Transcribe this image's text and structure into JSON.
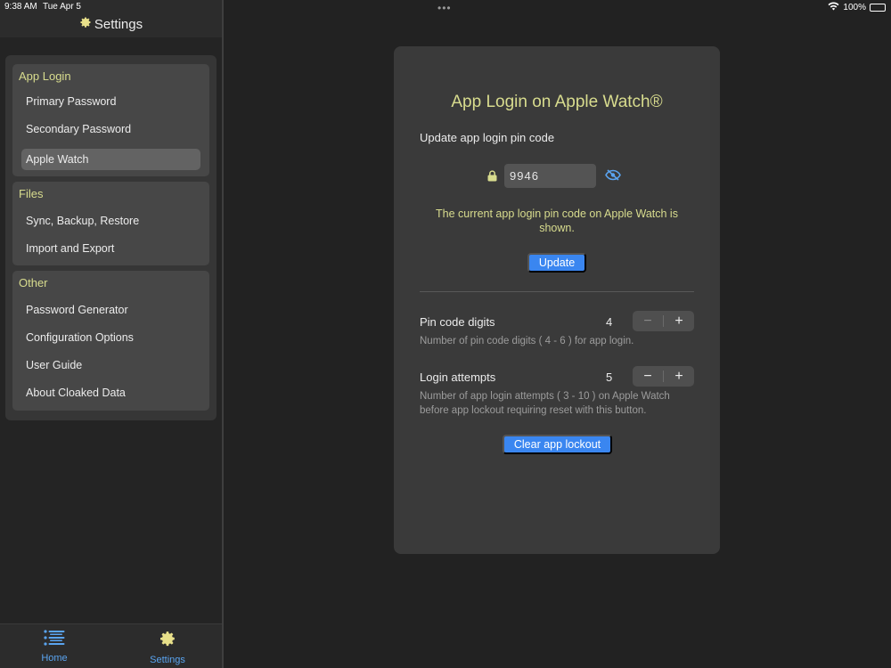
{
  "status_bar": {
    "time": "9:38 AM",
    "date": "Tue Apr 5",
    "battery": "100%"
  },
  "sidebar": {
    "title": "Settings",
    "groups": [
      {
        "title": "App Login",
        "items": [
          "Primary Password",
          "Secondary Password",
          "Apple Watch"
        ]
      },
      {
        "title": "Files",
        "items": [
          "Sync, Backup, Restore",
          "Import and Export"
        ]
      },
      {
        "title": "Other",
        "items": [
          "Password Generator",
          "Configuration Options",
          "User Guide",
          "About Cloaked Data"
        ]
      }
    ],
    "selected_item": "Apple Watch"
  },
  "tabbar": {
    "tabs": [
      "Home",
      "Settings"
    ]
  },
  "main": {
    "multitask_dots": "•••",
    "title": "App Login on Apple Watch®",
    "update_label": "Update app login pin code",
    "pin_value": "9946",
    "info_text": "The current app login pin code on Apple Watch is shown.",
    "update_button": "Update",
    "pin_digits": {
      "label": "Pin code digits",
      "value": "4",
      "description": "Number of pin code digits ( 4 - 6 ) for app login."
    },
    "login_attempts": {
      "label": "Login attempts",
      "value": "5",
      "description": "Number of app login attempts ( 3 - 10 ) on Apple Watch before app lockout requiring reset with this button."
    },
    "stepper_minus": "−",
    "stepper_plus": "+",
    "clear_button": "Clear app lockout"
  },
  "colors": {
    "accent_blue": "#3a86f0",
    "heading_yellow": "#d8dc8e",
    "panel_bg": "#3a3a3a"
  }
}
